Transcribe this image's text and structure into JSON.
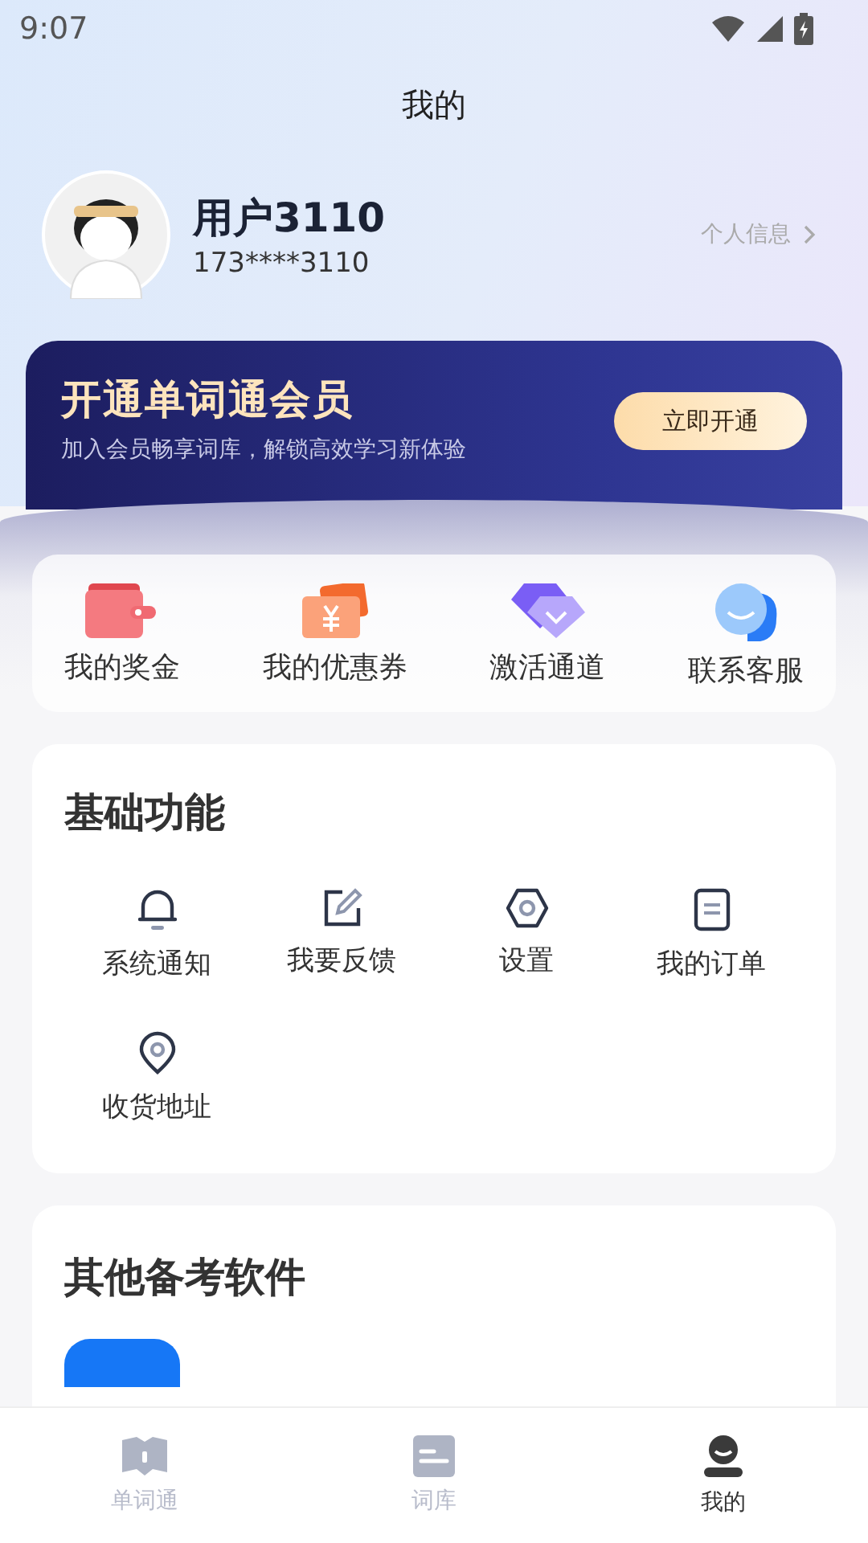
{
  "status_bar": {
    "time": "9:07"
  },
  "header": {
    "title": "我的"
  },
  "profile": {
    "name": "用户3110",
    "phone": "173****3110",
    "link": "个人信息"
  },
  "banner": {
    "title": "开通单词通会员",
    "subtitle": "加入会员畅享词库，解锁高效学习新体验",
    "button": "立即开通"
  },
  "quick_actions": [
    {
      "kind": "wallet",
      "label": "我的奖金"
    },
    {
      "kind": "coupon",
      "label": "我的优惠券"
    },
    {
      "kind": "diamond",
      "label": "激活通道"
    },
    {
      "kind": "service",
      "label": "联系客服"
    }
  ],
  "basic": {
    "title": "基础功能",
    "items": [
      {
        "kind": "bell",
        "label": "系统通知"
      },
      {
        "kind": "edit",
        "label": "我要反馈"
      },
      {
        "kind": "settings",
        "label": "设置"
      },
      {
        "kind": "order",
        "label": "我的订单"
      },
      {
        "kind": "location",
        "label": "收货地址"
      }
    ]
  },
  "other": {
    "title": "其他备考软件"
  },
  "nav": [
    {
      "kind": "book",
      "label": "单词通",
      "selected": false
    },
    {
      "kind": "library",
      "label": "词库",
      "selected": false
    },
    {
      "kind": "user",
      "label": "我的",
      "selected": true
    }
  ]
}
